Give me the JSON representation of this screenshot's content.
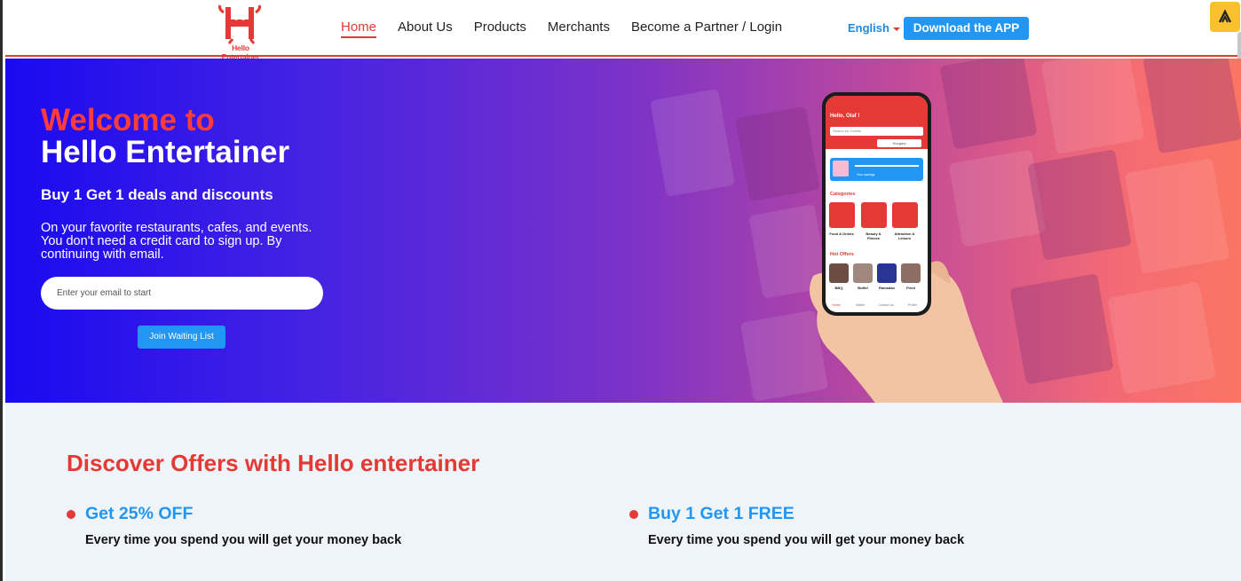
{
  "header": {
    "logo_text": "Hello Entertainer",
    "nav": [
      "Home",
      "About Us",
      "Products",
      "Merchants",
      "Become a Partner / Login"
    ],
    "active_nav": "Home",
    "language": "English",
    "download_label": "Download the APP"
  },
  "hero": {
    "title_line1": "Welcome to",
    "title_line2": "Hello Entertainer",
    "subtitle": "Buy 1 Get 1 deals and discounts",
    "description": "On your favorite restaurants, cafes, and events. You don't need a credit card to sign up. By continuing with email.",
    "email_placeholder": "Enter your email to start",
    "join_label": "Join Waiting List"
  },
  "phone": {
    "greeting": "Hello, Olaf !",
    "search_placeholder": "Search for Outlets",
    "region": "Hungary",
    "card_label": "Your savings",
    "categories_title": "Categories",
    "categories": [
      "Food & Drinks",
      "Beauty & Fitness",
      "Attraction & Leisure"
    ],
    "hot_offers_title": "Hot Offers",
    "hot_offers": [
      "BBQ",
      "Buffet",
      "Ramadan",
      "Fried"
    ],
    "tabs": [
      "Home",
      "Wallet",
      "Contact us",
      "Profile"
    ]
  },
  "offers": {
    "title": "Discover Offers with Hello entertainer",
    "items": [
      {
        "title": "Get 25% OFF",
        "description": "Every time you spend you will get your money back"
      },
      {
        "title": "Buy 1 Get 1 FREE",
        "description": "Every time you spend you will get your money back"
      }
    ]
  },
  "colors": {
    "brand_red": "#e53935",
    "brand_blue": "#2196f3",
    "hero_gradient_start": "#1a0af0",
    "hero_gradient_end": "#fb7564",
    "section_bg": "#eff4f9"
  }
}
